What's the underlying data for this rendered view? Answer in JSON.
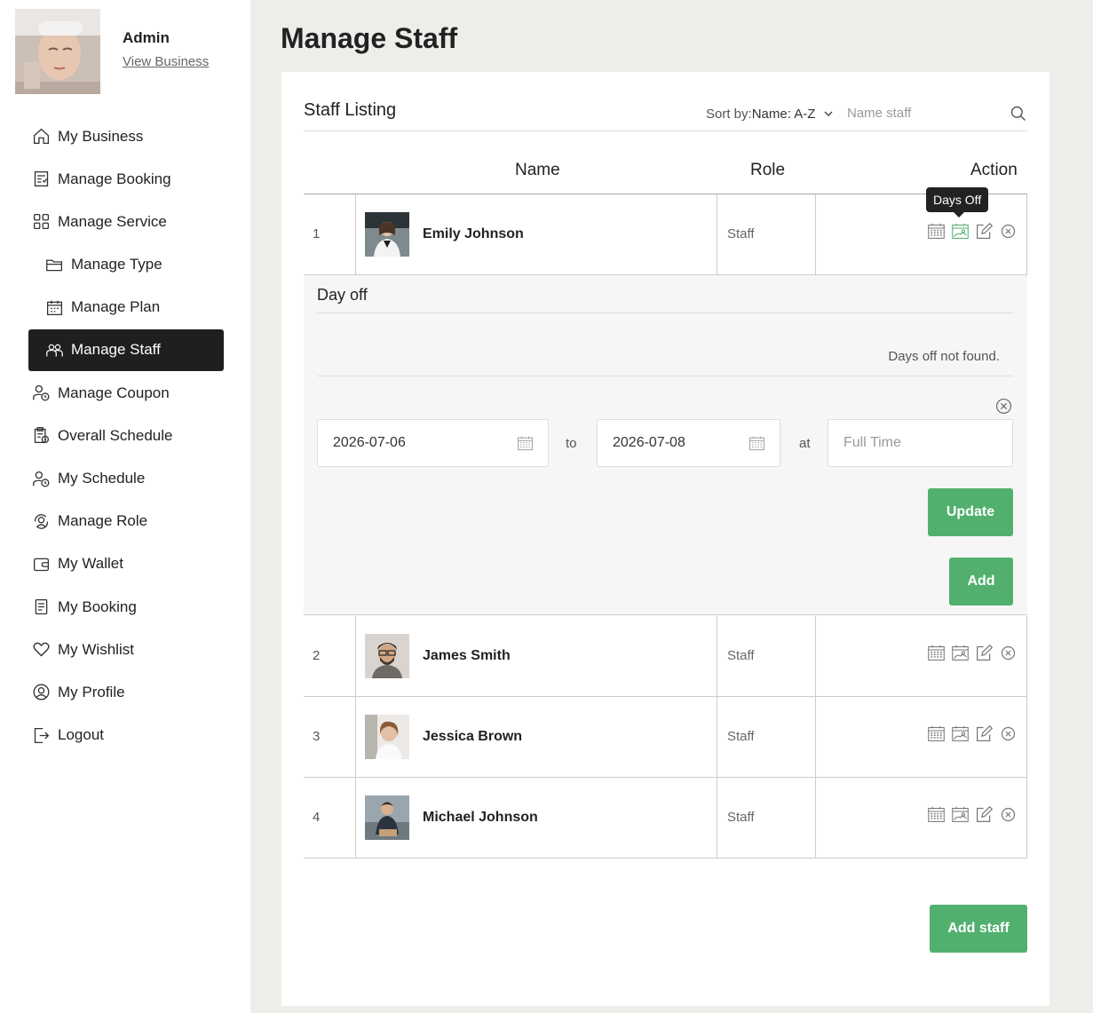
{
  "sidebar": {
    "user_name": "Admin",
    "view_business": "View Business",
    "items": [
      {
        "label": "My Business",
        "icon": "home-icon"
      },
      {
        "label": "Manage Booking",
        "icon": "booking-icon"
      },
      {
        "label": "Manage Service",
        "icon": "grid-icon"
      },
      {
        "label": "Manage Type",
        "icon": "folder-icon"
      },
      {
        "label": "Manage Plan",
        "icon": "calendar-icon"
      },
      {
        "label": "Manage Staff",
        "icon": "staff-icon"
      },
      {
        "label": "Manage Coupon",
        "icon": "user-clock-icon"
      },
      {
        "label": "Overall Schedule",
        "icon": "clipboard-clock-icon"
      },
      {
        "label": "My Schedule",
        "icon": "user-clock-icon"
      },
      {
        "label": "Manage Role",
        "icon": "user-cycle-icon"
      },
      {
        "label": "My Wallet",
        "icon": "wallet-icon"
      },
      {
        "label": "My Booking",
        "icon": "list-icon"
      },
      {
        "label": "My Wishlist",
        "icon": "heart-icon"
      },
      {
        "label": "My Profile",
        "icon": "user-circle-icon"
      },
      {
        "label": "Logout",
        "icon": "logout-icon"
      }
    ]
  },
  "page_title": "Manage Staff",
  "listing": {
    "title": "Staff Listing",
    "sort_label": "Sort by:",
    "sort_value": "Name: A-Z",
    "search_placeholder": "Name staff"
  },
  "table": {
    "headers": {
      "name": "Name",
      "role": "Role",
      "action": "Action"
    },
    "rows": [
      {
        "index": "1",
        "name": "Emily Johnson",
        "role": "Staff"
      },
      {
        "index": "2",
        "name": "James Smith",
        "role": "Staff"
      },
      {
        "index": "3",
        "name": "Jessica Brown",
        "role": "Staff"
      },
      {
        "index": "4",
        "name": "Michael Johnson",
        "role": "Staff"
      }
    ]
  },
  "tooltip": "Days Off",
  "dayoff": {
    "title": "Day off",
    "empty_text": "Days off not found.",
    "from_date": "2026-07-06",
    "to_label": "to",
    "to_date": "2026-07-08",
    "at_label": "at",
    "time_placeholder": "Full Time",
    "update_label": "Update",
    "add_label": "Add"
  },
  "add_staff_label": "Add staff",
  "colors": {
    "accent": "#52b06f",
    "active_nav": "#1f1f1f",
    "background": "#eeedea"
  }
}
